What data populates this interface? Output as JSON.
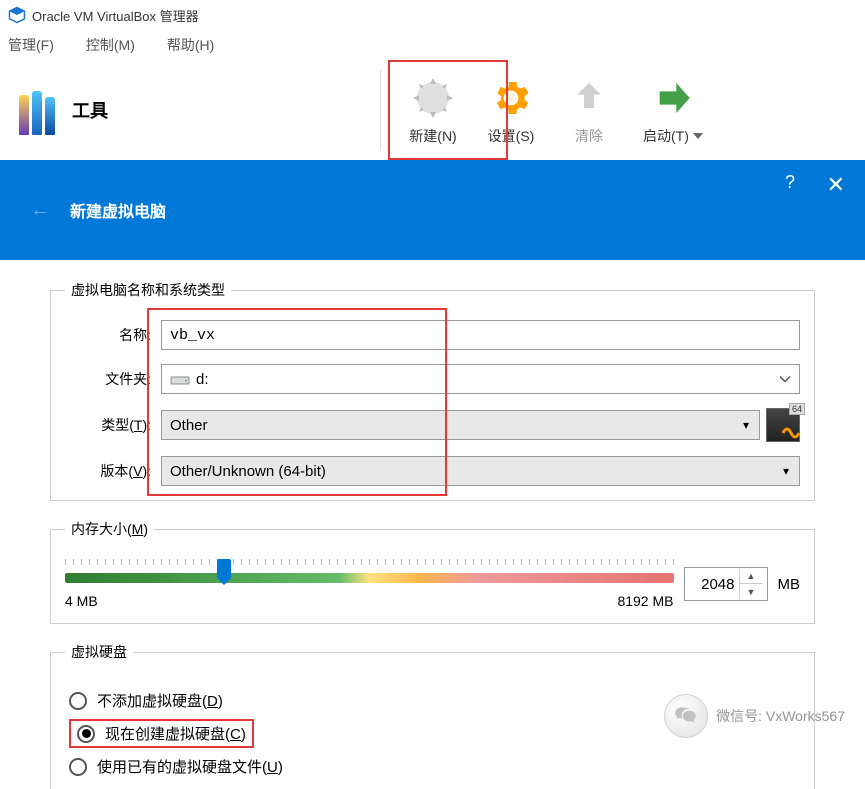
{
  "window": {
    "title": "Oracle VM VirtualBox 管理器"
  },
  "menubar": {
    "file": "管理(F)",
    "control": "控制(M)",
    "help": "帮助(H)"
  },
  "tools_label": "工具",
  "toolbar": {
    "new": "新建(N)",
    "settings": "设置(S)",
    "clear": "清除",
    "start": "启动(T)"
  },
  "wizard": {
    "title": "新建虚拟电脑",
    "help_glyph": "?",
    "close_glyph": "✕",
    "back_glyph": "←"
  },
  "section_name": {
    "legend": "虚拟电脑名称和系统类型",
    "label_name": "名称:",
    "value_name": "vb_vx",
    "label_folder": "文件夹:",
    "value_folder": "d:",
    "label_type_pre": "类型(",
    "label_type_u": "T",
    "label_type_post": "):",
    "value_type": "Other",
    "label_version_pre": "版本(",
    "label_version_u": "V",
    "label_version_post": "):",
    "value_version": "Other/Unknown (64-bit)",
    "badge64": "64"
  },
  "section_mem": {
    "legend_pre": "内存大小(",
    "legend_u": "M",
    "legend_post": ")",
    "min": "4 MB",
    "max": "8192 MB",
    "value": "2048",
    "unit": "MB"
  },
  "section_disk": {
    "legend": "虚拟硬盘",
    "opt1_pre": "不添加虚拟硬盘(",
    "opt1_u": "D",
    "opt1_post": ")",
    "opt2_pre": "现在创建虚拟硬盘(",
    "opt2_u": "C",
    "opt2_post": ")",
    "opt3_pre": "使用已有的虚拟硬盘文件(",
    "opt3_u": "U",
    "opt3_post": ")"
  },
  "watermark": {
    "text": "微信号: VxWorks567"
  }
}
